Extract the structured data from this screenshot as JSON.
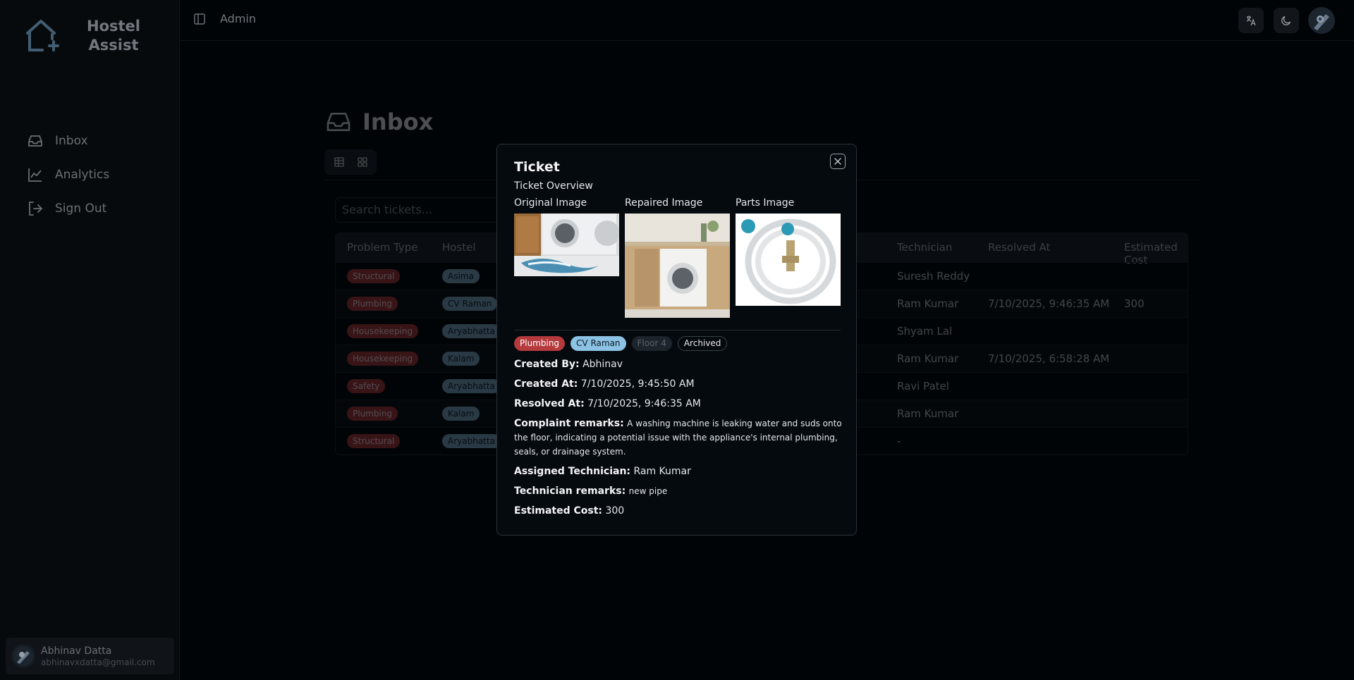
{
  "app": {
    "name_line1": "Hostel",
    "name_line2": "Assist"
  },
  "sidebar": {
    "items": [
      {
        "label": "Inbox",
        "icon": "inbox-icon"
      },
      {
        "label": "Analytics",
        "icon": "chart-icon"
      },
      {
        "label": "Sign Out",
        "icon": "sign-out-icon"
      }
    ],
    "user": {
      "name": "Abhinav Datta",
      "email": "abhinavxdatta@gmail.com"
    }
  },
  "topbar": {
    "breadcrumb": "Admin",
    "buttons": [
      "translate-icon",
      "moon-icon"
    ]
  },
  "page": {
    "title": "Inbox"
  },
  "search": {
    "placeholder": "Search tickets..."
  },
  "table": {
    "headers": {
      "problem_type": "Problem Type",
      "hostel": "Hostel",
      "technician": "Technician",
      "resolved_at": "Resolved At",
      "estimated_cost": "Estimated Cost"
    },
    "rows": [
      {
        "problem_type": "Structural",
        "hostel": "Asima",
        "technician": "Suresh Reddy",
        "resolved_at": "",
        "estimated_cost": ""
      },
      {
        "problem_type": "Plumbing",
        "hostel": "CV Raman",
        "technician": "Ram Kumar",
        "resolved_at": "7/10/2025, 9:46:35 AM",
        "estimated_cost": "300"
      },
      {
        "problem_type": "Housekeeping",
        "hostel": "Aryabhatta",
        "technician": "Shyam Lal",
        "resolved_at": "",
        "estimated_cost": ""
      },
      {
        "problem_type": "Housekeeping",
        "hostel": "Kalam",
        "technician": "Ram Kumar",
        "resolved_at": "7/10/2025, 6:58:28 AM",
        "estimated_cost": ""
      },
      {
        "problem_type": "Safety",
        "hostel": "Aryabhatta",
        "technician": "Ravi Patel",
        "resolved_at": "",
        "estimated_cost": ""
      },
      {
        "problem_type": "Plumbing",
        "hostel": "Kalam",
        "technician": "Ram Kumar",
        "resolved_at": "",
        "estimated_cost": ""
      },
      {
        "problem_type": "Structural",
        "hostel": "Aryabhatta",
        "technician": "-",
        "resolved_at": "",
        "estimated_cost": ""
      }
    ]
  },
  "modal": {
    "title": "Ticket",
    "subtitle": "Ticket Overview",
    "images": {
      "original": "Original Image",
      "repaired": "Repaired Image",
      "parts": "Parts Image"
    },
    "tags": {
      "problem": "Plumbing",
      "hostel": "CV Raman",
      "floor": "Floor 4",
      "status": "Archived"
    },
    "created_by_label": "Created By:",
    "created_by": "Abhinav",
    "created_at_label": "Created At:",
    "created_at": "7/10/2025, 9:45:50 AM",
    "resolved_at_label": "Resolved At:",
    "resolved_at": "7/10/2025, 9:46:35 AM",
    "remarks_label": "Complaint remarks:",
    "remarks": "A washing machine is leaking water and suds onto the floor, indicating a potential issue with the appliance's internal plumbing, seals, or drainage system.",
    "technician_label": "Assigned Technician:",
    "technician": "Ram Kumar",
    "tech_remarks_label": "Technician remarks:",
    "tech_remarks": "new pipe",
    "cost_label": "Estimated Cost:",
    "cost": "300"
  },
  "colors": {
    "accent_red": "#b53a3d",
    "accent_blue": "#8cc2e3",
    "background": "#02060a"
  }
}
